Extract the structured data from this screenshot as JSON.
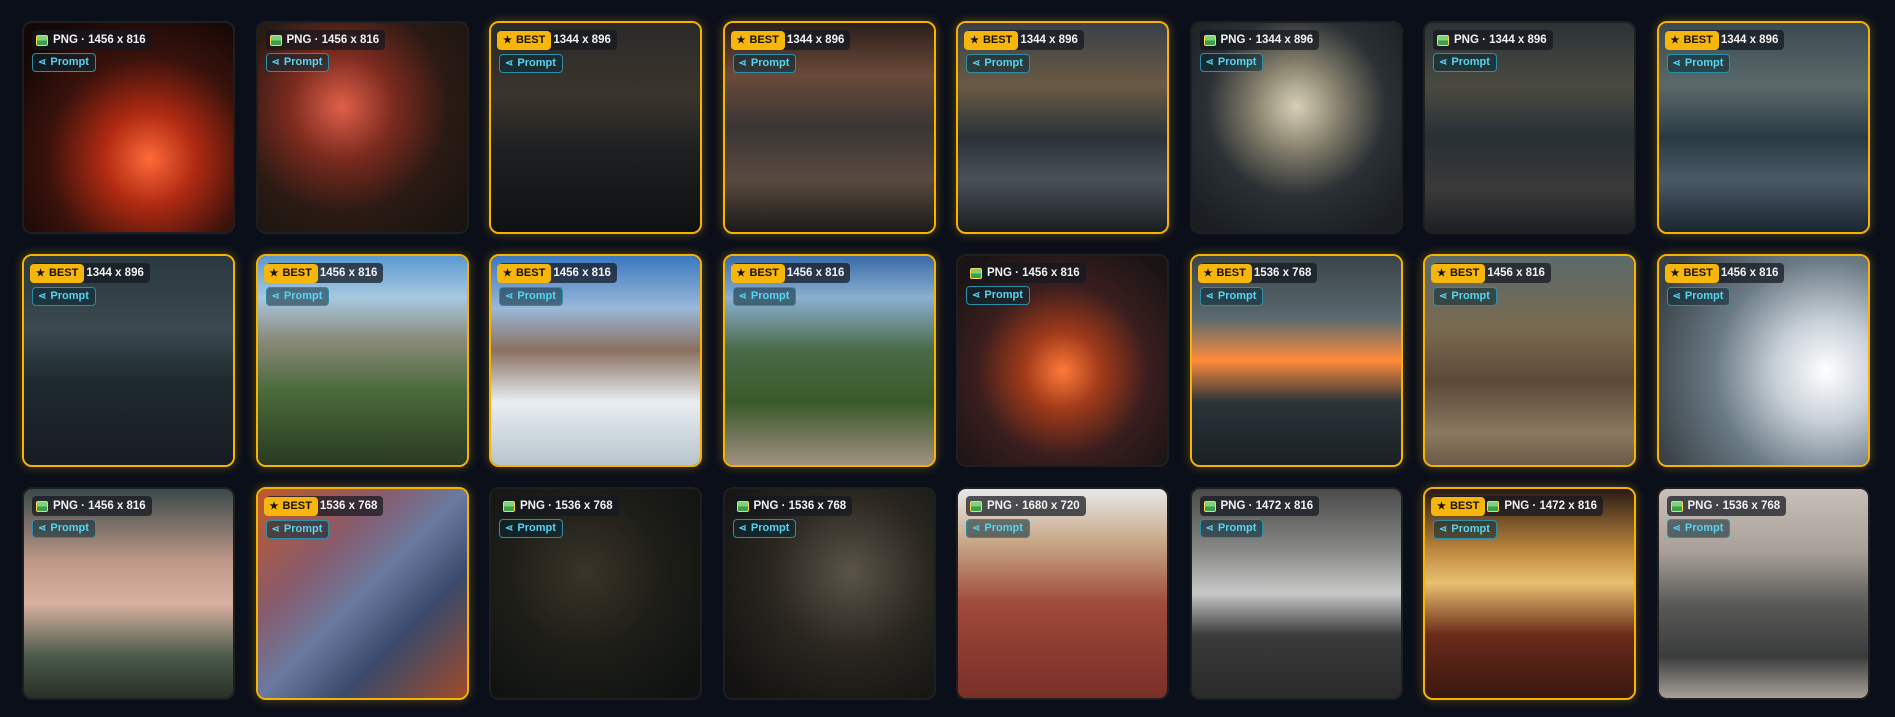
{
  "prompt_label": "Prompt",
  "best_label": "BEST",
  "icons": {
    "best": "star-icon",
    "prompt": "share-icon",
    "format": "image-file-icon"
  },
  "colors": {
    "background": "#0b0f1a",
    "best_border": "#f5b400",
    "prompt_text": "#57d4f0"
  },
  "cards": [
    {
      "best": false,
      "label": "PNG · 1456 x 816",
      "bg": "radial-gradient(circle at 60% 65%, #ff6a3a 0%, #b02a12 25%, #3a120c 55%, #140806 85%)"
    },
    {
      "best": false,
      "label": "PNG · 1456 x 816",
      "bg": "radial-gradient(circle at 40% 40%, #e0604a 0%, #7a2a1e 30%, #2b1a14 60%, #1a1410 90%)"
    },
    {
      "best": true,
      "label": "1344 x 896",
      "bg": "linear-gradient(180deg,#2a2a28 0%,#3a352c 35%,#1e2022 60%,#0f1112 100%)"
    },
    {
      "best": true,
      "label": "1344 x 896",
      "bg": "linear-gradient(180deg,#2a1e1a 0%,#6a4a3a 25%,#3a3634 50%,#5a4a40 75%,#1c1a18 100%)"
    },
    {
      "best": true,
      "label": "1344 x 896",
      "bg": "linear-gradient(180deg,#3a4048 0%,#6a5a44 30%,#2a3238 55%,#4a5058 75%,#1a1e22 100%)"
    },
    {
      "best": false,
      "label": "PNG · 1344 x 896",
      "bg": "radial-gradient(circle at 50% 40%, #d8d0b8 0%, #8a8470 25%, #2a3034 55%, #1a1e22 90%)"
    },
    {
      "best": false,
      "label": "PNG · 1344 x 896",
      "bg": "linear-gradient(180deg,#2c3236 0%,#4a4a40 30%,#283036 55%,#3a3a38 80%,#1c2024 100%)"
    },
    {
      "best": true,
      "label": "1344 x 896",
      "bg": "linear-gradient(180deg,#3a4a50 0%,#5a6a6a 30%,#2a3a44 55%,#4a5a66 75%,#1a2630 100%)"
    },
    {
      "best": true,
      "label": "1344 x 896",
      "bg": "linear-gradient(180deg,#2a3840 0%,#3a4a50 35%,#1e2a30 60%,#181c22 100%)"
    },
    {
      "best": true,
      "label": "1456 x 816",
      "bg": "linear-gradient(180deg,#5a9ad0 0%,#a8c8e0 20%,#8a8a7a 40%,#4a6a3a 65%,#2a3a22 100%)"
    },
    {
      "best": true,
      "label": "1456 x 816",
      "bg": "linear-gradient(180deg,#3a78c0 0%,#9ab8d8 25%,#8a7060 45%,#e8eef2 70%,#b8c4cc 100%)"
    },
    {
      "best": true,
      "label": "1456 x 816",
      "bg": "linear-gradient(180deg,#3a6aa8 0%,#8ab0d0 20%,#4a6a48 45%,#3a5a2a 70%,#a09080 100%)"
    },
    {
      "best": false,
      "label": "PNG · 1456 x 816",
      "bg": "radial-gradient(circle at 50% 55%, #ff7a3a 0%, #a03a1a 25%, #3a1e1e 55%, #1a1414 90%)"
    },
    {
      "best": true,
      "label": "1536 x 768",
      "bg": "linear-gradient(180deg,#3a4448 0%,#5a6a70 30%,#ff8a3a 50%,#2a3438 70%,#1a2024 100%)"
    },
    {
      "best": true,
      "label": "1456 x 816",
      "bg": "linear-gradient(180deg,#5a6a6a 0%,#7a6a50 35%,#5a4a38 60%,#8a7a60 85%,#6a5a48 100%)"
    },
    {
      "best": true,
      "label": "1456 x 816",
      "bg": "radial-gradient(circle at 80% 55%, #ffffff 0%, #c8d0d8 25%, #6a7a84 55%, #3a4248 90%)"
    },
    {
      "best": false,
      "label": "PNG · 1456 x 816",
      "bg": "linear-gradient(180deg,#3a4a4a 0%,#c09888 35%,#d8b0a0 55%,#4a5a4a 80%,#2a3028 100%)"
    },
    {
      "best": true,
      "label": "1536 x 768",
      "bg": "linear-gradient(135deg,#c05a2a 0%,#8a5a6a 30%,#6a7aa0 50%,#3a4a6a 70%,#a04a2a 100%)"
    },
    {
      "best": false,
      "label": "PNG · 1536 x 768",
      "bg": "radial-gradient(circle at 45% 40%, #3a3428 0%, #1e1e18 45%, #0e1210 90%)"
    },
    {
      "best": false,
      "label": "PNG · 1536 x 768",
      "bg": "radial-gradient(circle at 60% 40%, #5a5448 0%, #2a2620 45%, #121210 90%)"
    },
    {
      "best": false,
      "label": "PNG · 1680 x 720",
      "bg": "linear-gradient(180deg,#e8e8e8 0%,#c8a888 25%,#a04a3a 55%,#8a3a30 80%,#7a3028 100%)"
    },
    {
      "best": false,
      "label": "PNG · 1472 x 816",
      "bg": "linear-gradient(180deg,#4a4a4a 0%,#8a8a88 30%,#c8c8c8 50%,#3a3a3a 70%,#2a2a2a 100%)"
    },
    {
      "best": true,
      "label": "PNG · 1472 x 816",
      "bg": "linear-gradient(180deg,#2a1a14 0%,#c08a40 30%,#e8c070 45%,#6a2a1a 70%,#3a1810 100%)"
    },
    {
      "best": false,
      "label": "PNG · 1536 x 768",
      "bg": "linear-gradient(180deg,#c8c0b8 0%,#a8a098 30%,#5a5a58 55%,#3a3c3c 80%,#a8a098 100%)"
    }
  ]
}
